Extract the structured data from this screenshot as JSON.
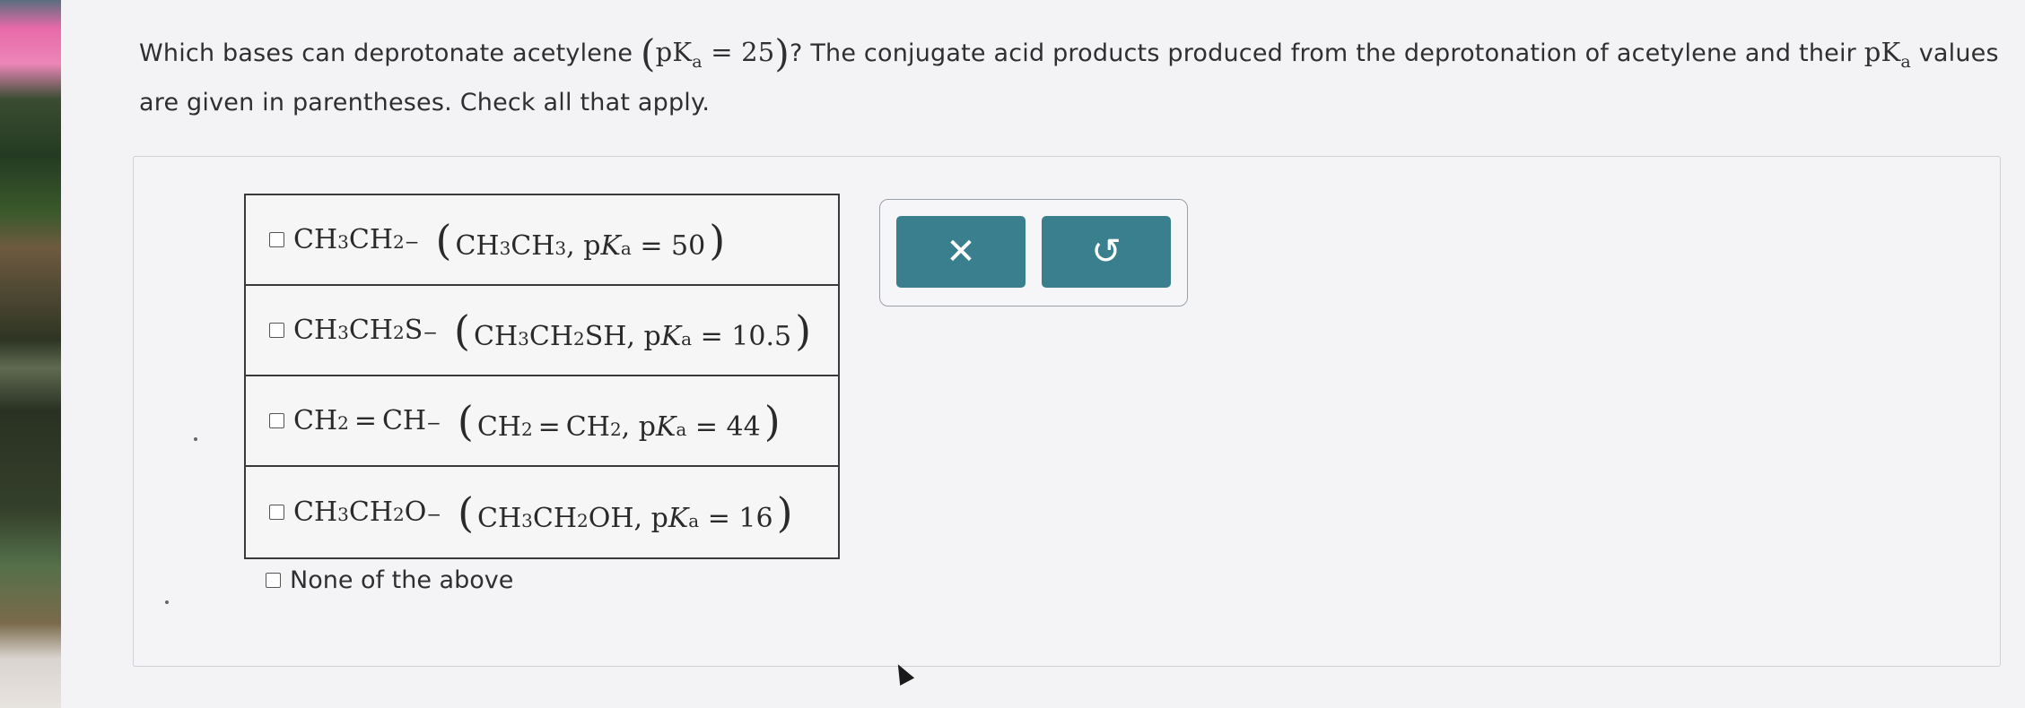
{
  "question": {
    "text_before": "Which bases can deprotonate acetylene",
    "acetylene_pka_label": "pK",
    "acetylene_pka_sub": "a",
    "acetylene_pka_value": "= 25",
    "text_middle": "? The conjugate acid products produced from the deprotonation of acetylene and their",
    "pka_label": "pK",
    "pka_sub": "a",
    "text_after": "values are given in parentheses. Check all that apply."
  },
  "choices": [
    {
      "base": [
        "CH",
        "3",
        "CH",
        "2",
        "−"
      ],
      "acid": "CH3CH3",
      "value": "= 50"
    },
    {
      "base": "CH3CH2S−",
      "acid": "CH3CH2SH",
      "value": "= 10.5"
    },
    {
      "base": "CH2=CH−",
      "acid": "CH2=CH2",
      "value": "= 44"
    },
    {
      "base": "CH3CH2O−",
      "acid": "CH3CH2OH",
      "value": "= 16"
    }
  ],
  "none_label": "None of the above",
  "toolbar": {
    "clear_icon": "✕",
    "undo_icon": "↺"
  },
  "colors": {
    "button_bg": "#3a7f8e",
    "page_bg": "#f3f3f5"
  }
}
